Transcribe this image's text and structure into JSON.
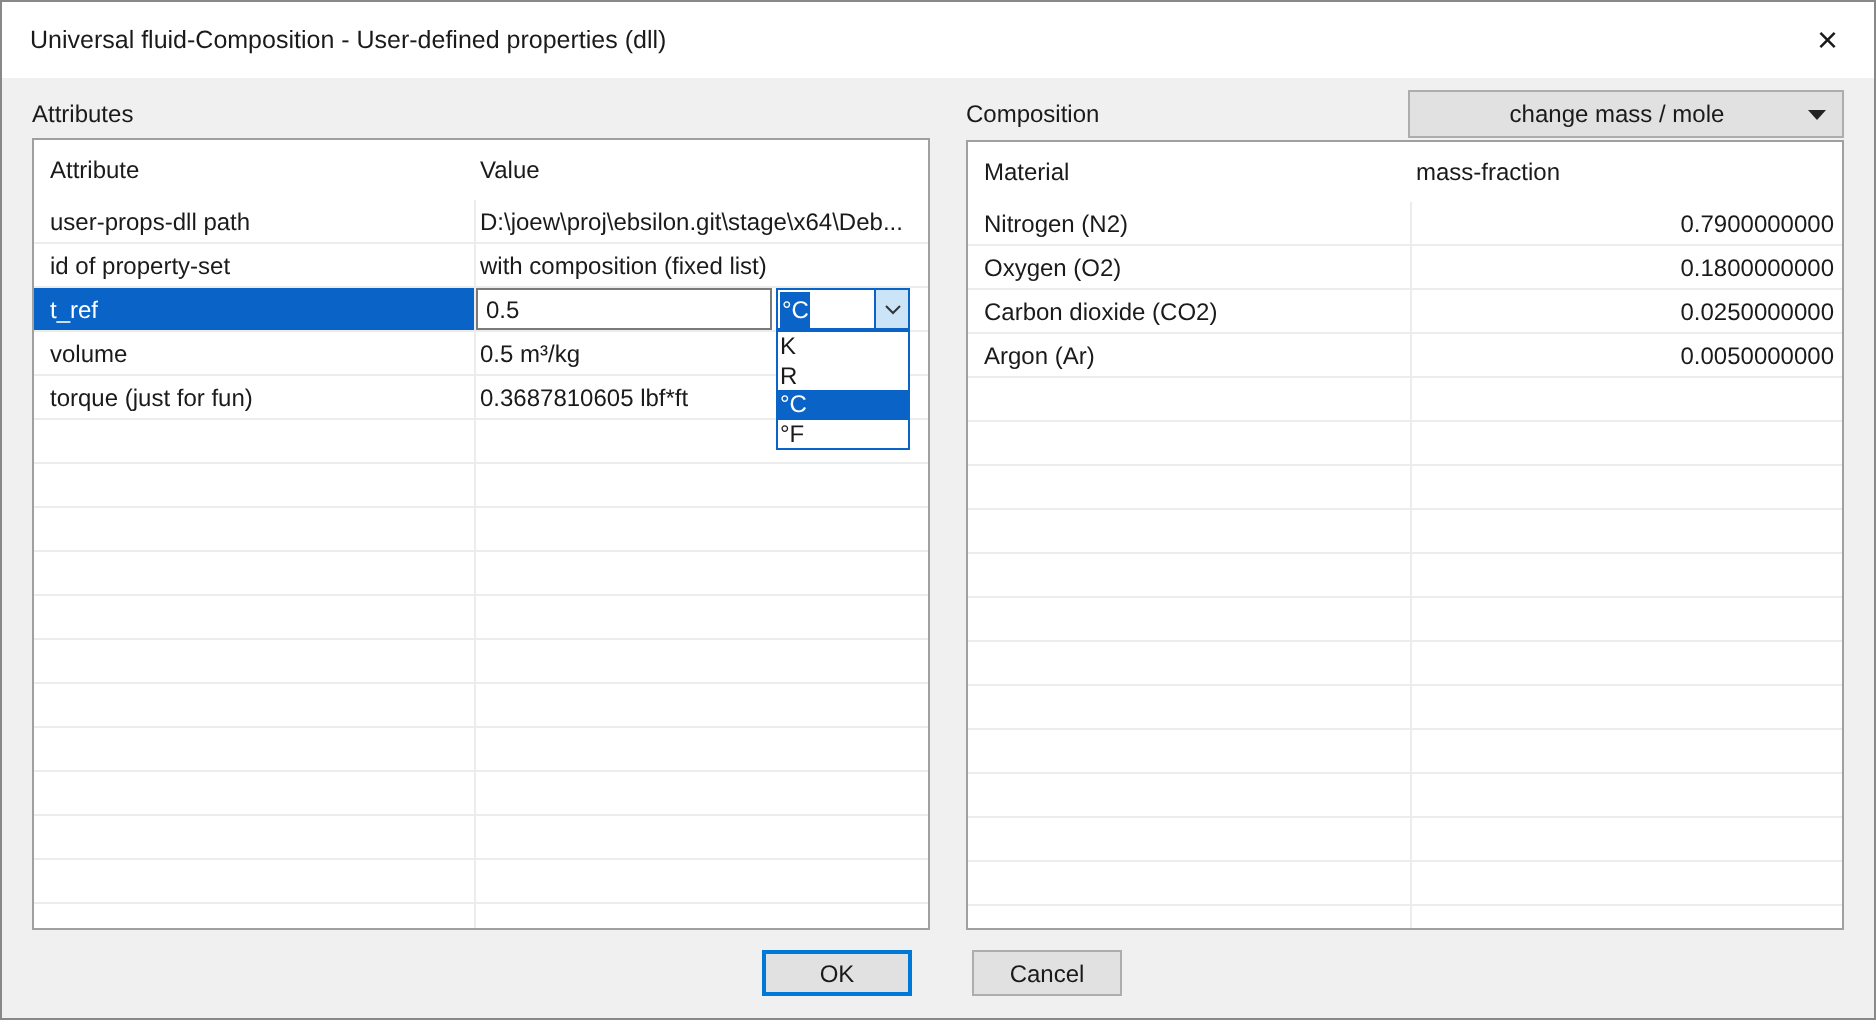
{
  "window": {
    "title": "Universal fluid-Composition - User-defined properties (dll)",
    "close": "×"
  },
  "attributes": {
    "label": "Attributes",
    "columns": [
      "Attribute",
      "Value"
    ],
    "rows": [
      {
        "name": "user-props-dll path",
        "value": "D:\\joew\\proj\\ebsilon.git\\stage\\x64\\Deb...",
        "selected": false
      },
      {
        "name": "id of property-set",
        "value": "with composition (fixed list)",
        "selected": false
      },
      {
        "name": "t_ref",
        "value": "0.5",
        "selected": true,
        "kind": "editor",
        "unit": "°C",
        "options": [
          {
            "label": "K",
            "selected": false
          },
          {
            "label": "R",
            "selected": false
          },
          {
            "label": "°C",
            "selected": true
          },
          {
            "label": "°F",
            "selected": false
          }
        ]
      },
      {
        "name": "volume",
        "value": "0.5 m³/kg",
        "selected": false
      },
      {
        "name": "torque (just for fun)",
        "value": "0.3687810605 lbf*ft",
        "selected": false
      }
    ]
  },
  "composition": {
    "label": "Composition",
    "mode_button": "change mass / mole",
    "columns": [
      "Material",
      "mass-fraction"
    ],
    "rows": [
      {
        "material": "Nitrogen (N2)",
        "fraction": "0.7900000000"
      },
      {
        "material": "Oxygen (O2)",
        "fraction": "0.1800000000"
      },
      {
        "material": "Carbon dioxide (CO2)",
        "fraction": "0.0250000000"
      },
      {
        "material": "Argon (Ar)",
        "fraction": "0.0050000000"
      }
    ]
  },
  "buttons": [
    {
      "label": "OK",
      "default": true
    },
    {
      "label": "Cancel",
      "default": false
    }
  ]
}
